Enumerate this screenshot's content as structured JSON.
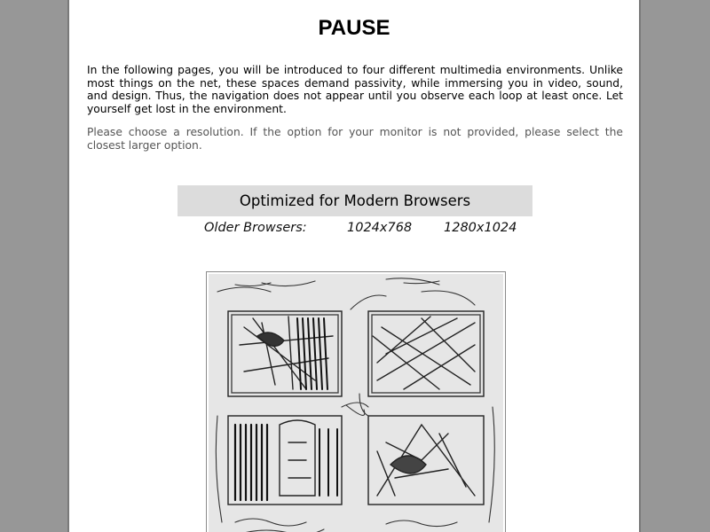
{
  "page": {
    "title": "PAUSE",
    "intro": "In the following pages, you will be introduced to four different multimedia environments. Unlike most things on the net, these spaces demand passivity, while immersing you in video, sound, and design. Thus, the navigation does not appear until you observe each loop at least once. Let yourself get lost in the environment.",
    "hint": "Please choose a resolution. If the option for your monitor is not provided, please select the closest larger option."
  },
  "options": {
    "optimized_label": "Optimized for Modern Browsers",
    "older_label": "Older Browsers:",
    "res_1024": "1024x768",
    "res_1280": "1280x1024"
  },
  "colors": {
    "backdrop": "#979797",
    "page": "#ffffff",
    "optimized_bg": "#dcdcdc"
  },
  "sketch": {
    "panels": [
      "top-left",
      "top-right",
      "bottom-left",
      "bottom-right"
    ]
  }
}
